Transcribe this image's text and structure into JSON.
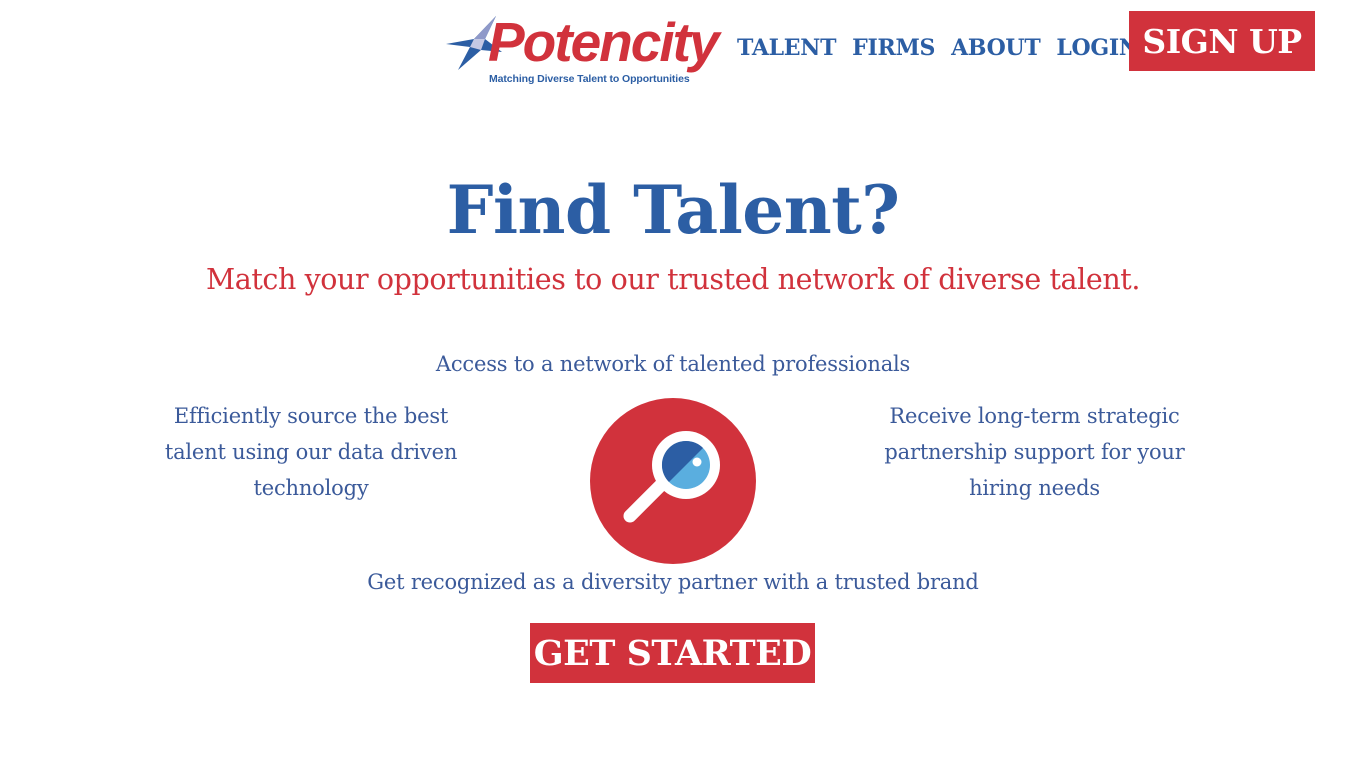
{
  "header": {
    "logo": {
      "name": "Potencity",
      "tagline": "Matching Diverse Talent to Opportunities",
      "icon": "star-icon"
    },
    "nav": [
      {
        "label": "TALENT"
      },
      {
        "label": "FIRMS"
      },
      {
        "label": "ABOUT"
      },
      {
        "label": "LOGIN"
      }
    ],
    "signup_label": "SIGN UP"
  },
  "hero": {
    "title": "Find Talent?",
    "subtitle": "Match your opportunities to our trusted network of diverse talent."
  },
  "features": {
    "top": "Access to a network of talented professionals",
    "left": "Efficiently source the best talent using our data driven technology",
    "right": "Receive long-term strategic partnership support for your hiring needs",
    "bottom": "Get recognized as a diversity partner with a trusted brand",
    "icon": "magnifying-glass-icon"
  },
  "cta": {
    "label": "GET STARTED"
  },
  "colors": {
    "brand_blue": "#2c5ea4",
    "brand_red": "#d1323c",
    "text_blue": "#3b5a9a",
    "lens_light": "#5aaedf",
    "lens_dark": "#2c5ea4"
  }
}
